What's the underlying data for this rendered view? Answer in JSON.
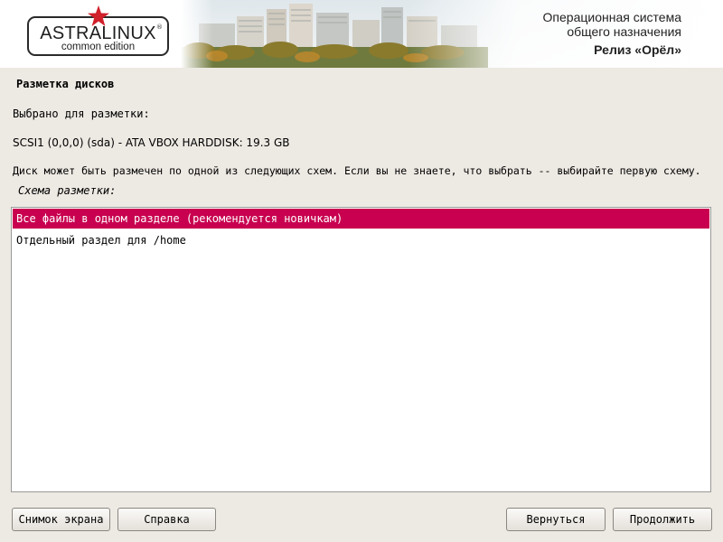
{
  "header": {
    "logo_title": "ASTRALINUX",
    "logo_sub": "common edition",
    "logo_reg": "®",
    "os_line1": "Операционная система",
    "os_line2": "общего назначения",
    "release": "Релиз «Орёл»",
    "star_color": "#d0202a"
  },
  "page": {
    "title": "Разметка дисков",
    "selected_label": "Выбрано для разметки:",
    "disk": "SCSI1 (0,0,0) (sda) - ATA VBOX HARDDISK: 19.3 GB",
    "description": "Диск может быть размечен по одной из следующих схем. Если вы не знаете, что выбрать -- выбирайте первую схему.",
    "scheme_label": "Схема разметки:"
  },
  "options": [
    {
      "label": "Все файлы в одном разделе (рекомендуется новичкам)",
      "selected": true
    },
    {
      "label": "Отдельный раздел для /home",
      "selected": false
    }
  ],
  "buttons": {
    "screenshot": "Снимок экрана",
    "help": "Справка",
    "back": "Вернуться",
    "continue": "Продолжить"
  },
  "colors": {
    "selection": "#c8004f",
    "background": "#ede9e3"
  }
}
